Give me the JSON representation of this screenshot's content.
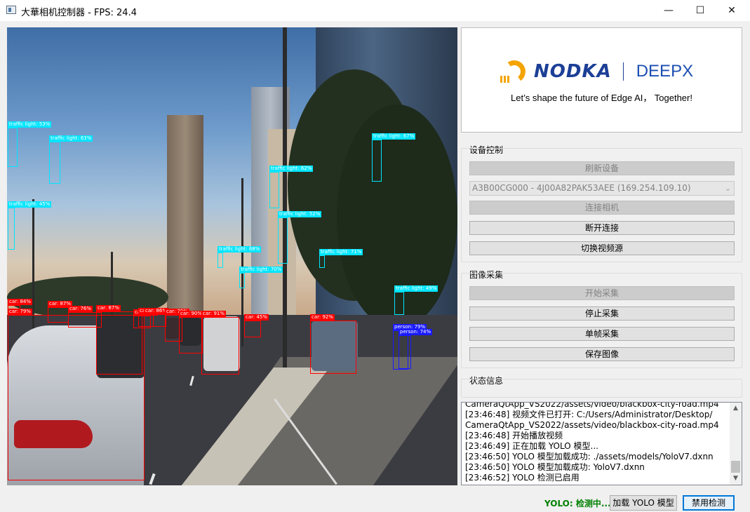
{
  "window": {
    "title": "大華相机控制器 - FPS: 24.4",
    "controls": {
      "minimize": "—",
      "maximize": "☐",
      "close": "✕"
    }
  },
  "video": {
    "detections": [
      {
        "label": "traffic light: 53%",
        "cls": "traffic"
      },
      {
        "label": "traffic light: 63%",
        "cls": "traffic"
      },
      {
        "label": "traffic light: 45%",
        "cls": "traffic"
      },
      {
        "label": "traffic light: 62%",
        "cls": "traffic"
      },
      {
        "label": "traffic light: 52%",
        "cls": "traffic"
      },
      {
        "label": "traffic light: 68%",
        "cls": "traffic"
      },
      {
        "label": "traffic light: 70%",
        "cls": "traffic"
      },
      {
        "label": "traffic light: 71%",
        "cls": "traffic"
      },
      {
        "label": "traffic light: 67%",
        "cls": "traffic"
      },
      {
        "label": "traffic light: 49%",
        "cls": "traffic"
      },
      {
        "label": "car: 84%",
        "cls": "car"
      },
      {
        "label": "car: 87%",
        "cls": "car"
      },
      {
        "label": "car: 76%",
        "cls": "car"
      },
      {
        "label": "car: 87%",
        "cls": "car"
      },
      {
        "label": "car: 76%",
        "cls": "car"
      },
      {
        "label": "car: 78%",
        "cls": "car"
      },
      {
        "label": "car: 86%",
        "cls": "car"
      },
      {
        "label": "car: 79%",
        "cls": "car"
      },
      {
        "label": "car: 90%",
        "cls": "car"
      },
      {
        "label": "car: 91%",
        "cls": "car"
      },
      {
        "label": "car: 45%",
        "cls": "car"
      },
      {
        "label": "car: 92%",
        "cls": "car"
      },
      {
        "label": "car: 79%",
        "cls": "car"
      },
      {
        "label": "person: 79%",
        "cls": "person"
      },
      {
        "label": "person: 74%",
        "cls": "person"
      }
    ],
    "colors": {
      "car": "#ff0000",
      "traffic": "#00e5ff",
      "person": "#1a1aff"
    }
  },
  "brand": {
    "nodka": "NODKA",
    "deepx": "DEEPX",
    "slogan": "Let’s shape the future of Edge AI， Together!"
  },
  "device": {
    "group_title": "设备控制",
    "refresh": "刷新设备",
    "selected_device": "A3B00CG000 - 4J00A82PAK53AEE (169.254.109.10)",
    "connect": "连接相机",
    "disconnect": "断开连接",
    "switch_source": "切换视频源"
  },
  "capture": {
    "group_title": "图像采集",
    "start": "开始采集",
    "stop": "停止采集",
    "single": "单帧采集",
    "save": "保存图像"
  },
  "status": {
    "group_title": "状态信息",
    "log": [
      "CameraQtApp_VS2022/assets/video/blackbox-city-road.mp4",
      "[23:46:48] 视频文件已打开: C:/Users/Administrator/Desktop/",
      "CameraQtApp_VS2022/assets/video/blackbox-city-road.mp4",
      "[23:46:48] 开始播放视频",
      "[23:46:49] 正在加载 YOLO 模型...",
      "[23:46:50] YOLO 模型加载成功: ./assets/models/YoloV7.dxnn",
      "[23:46:50] YOLO 模型加载成功: YoloV7.dxnn",
      "[23:46:52] YOLO 检测已启用"
    ],
    "yolo_state": "YOLO: 检测中...",
    "load_model": "加载 YOLO 模型",
    "disable_detect": "禁用检测",
    "detect_color": "#008000"
  }
}
